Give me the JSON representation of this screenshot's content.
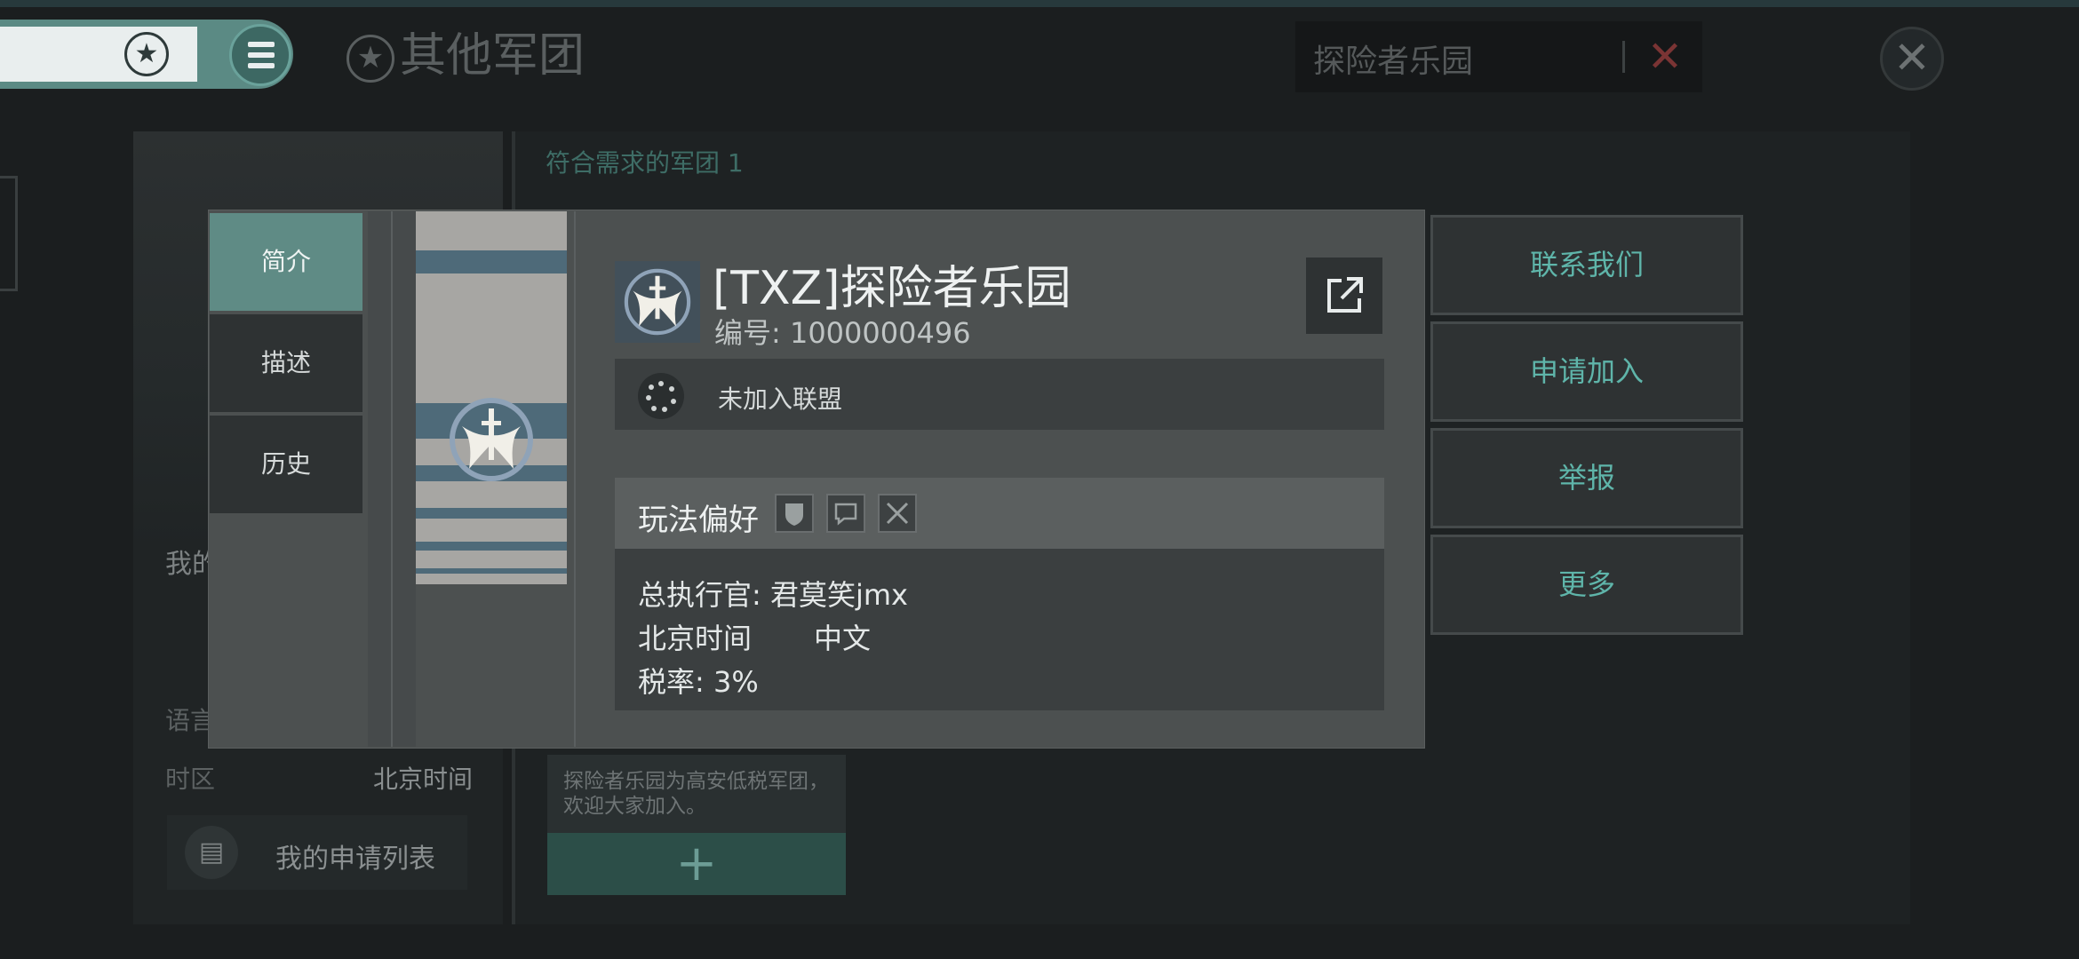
{
  "topbar": {
    "page_title": "其他军团",
    "search_value": "探险者乐园",
    "clear_symbol": "✕",
    "close_symbol": "✕",
    "star_symbol": "★"
  },
  "background": {
    "match_label": "符合需求的军团 1",
    "my_label": "我的",
    "language_label": "语言",
    "timezone_label": "时区",
    "timezone_value": "北京时间",
    "apply_list_label": "我的申请列表",
    "card_text": "探险者乐园为高安低税军团，欢迎大家加入。",
    "card_plus": "+"
  },
  "modal": {
    "tabs": [
      {
        "label": "简介",
        "active": true
      },
      {
        "label": "描述",
        "active": false
      },
      {
        "label": "历史",
        "active": false
      }
    ],
    "guild_name": "[TXZ]探险者乐园",
    "guild_id": "编号: 1000000496",
    "alliance_status": "未加入联盟",
    "pref_label": "玩法偏好",
    "pref_icons": [
      "shield-icon",
      "chat-icon",
      "crossed-swords-icon"
    ],
    "commander": "总执行官: 君莫笑jmx",
    "timezone": "北京时间",
    "language": "中文",
    "tax": "税率: 3%"
  },
  "actions": [
    {
      "label": "联系我们"
    },
    {
      "label": "申请加入"
    },
    {
      "label": "举报"
    },
    {
      "label": "更多"
    }
  ],
  "colors": {
    "accent_teal": "#5fb5aa",
    "active_tab": "#5f8b85",
    "banner_stripe": "#4e6a79",
    "clear_red": "#7a3434"
  }
}
